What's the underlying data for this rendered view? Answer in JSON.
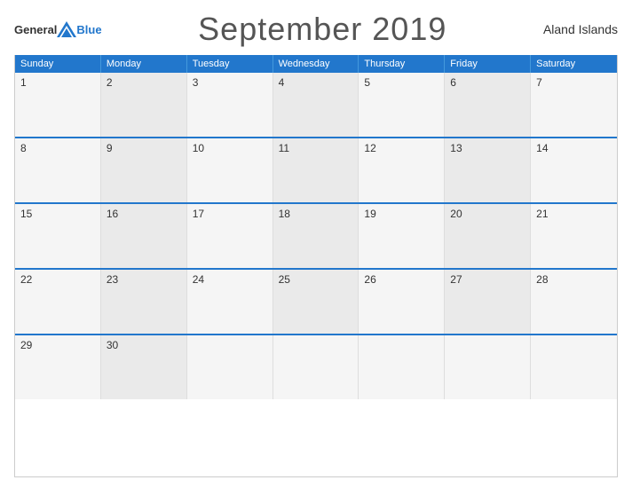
{
  "header": {
    "logo_general": "General",
    "logo_blue": "Blue",
    "title": "September 2019",
    "region": "Aland Islands"
  },
  "days_of_week": [
    "Sunday",
    "Monday",
    "Tuesday",
    "Wednesday",
    "Thursday",
    "Friday",
    "Saturday"
  ],
  "weeks": [
    [
      {
        "num": "1",
        "empty": false
      },
      {
        "num": "2",
        "empty": false
      },
      {
        "num": "3",
        "empty": false
      },
      {
        "num": "4",
        "empty": false
      },
      {
        "num": "5",
        "empty": false
      },
      {
        "num": "6",
        "empty": false
      },
      {
        "num": "7",
        "empty": false
      }
    ],
    [
      {
        "num": "8",
        "empty": false
      },
      {
        "num": "9",
        "empty": false
      },
      {
        "num": "10",
        "empty": false
      },
      {
        "num": "11",
        "empty": false
      },
      {
        "num": "12",
        "empty": false
      },
      {
        "num": "13",
        "empty": false
      },
      {
        "num": "14",
        "empty": false
      }
    ],
    [
      {
        "num": "15",
        "empty": false
      },
      {
        "num": "16",
        "empty": false
      },
      {
        "num": "17",
        "empty": false
      },
      {
        "num": "18",
        "empty": false
      },
      {
        "num": "19",
        "empty": false
      },
      {
        "num": "20",
        "empty": false
      },
      {
        "num": "21",
        "empty": false
      }
    ],
    [
      {
        "num": "22",
        "empty": false
      },
      {
        "num": "23",
        "empty": false
      },
      {
        "num": "24",
        "empty": false
      },
      {
        "num": "25",
        "empty": false
      },
      {
        "num": "26",
        "empty": false
      },
      {
        "num": "27",
        "empty": false
      },
      {
        "num": "28",
        "empty": false
      }
    ],
    [
      {
        "num": "29",
        "empty": false
      },
      {
        "num": "30",
        "empty": false
      },
      {
        "num": "",
        "empty": true
      },
      {
        "num": "",
        "empty": true
      },
      {
        "num": "",
        "empty": true
      },
      {
        "num": "",
        "empty": true
      },
      {
        "num": "",
        "empty": true
      }
    ]
  ]
}
